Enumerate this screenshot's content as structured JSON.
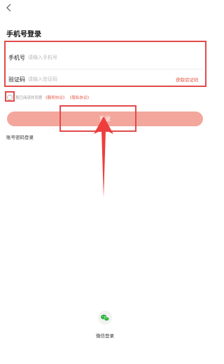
{
  "header": {
    "title": "手机号登录"
  },
  "form": {
    "phone_label": "手机号",
    "phone_placeholder": "请输入手机号",
    "code_label": "验证码",
    "code_placeholder": "请输入验证码",
    "get_code_label": "获取验证码"
  },
  "agreement": {
    "prefix": "我已阅读并同意",
    "service_link": "《服务协议》",
    "privacy_link": "《隐私协议》"
  },
  "actions": {
    "login_label": "登录",
    "password_login_label": "账号密码登录"
  },
  "third_party": {
    "wechat_label": "微信登录"
  },
  "colors": {
    "accent": "#e0533f",
    "login_button": "#f3a79c",
    "annotation": "#e24a4a",
    "wechat": "#29b33b"
  },
  "icons": {
    "back": "chevron-left-icon",
    "wechat": "wechat-icon",
    "annotation_arrow": "up-arrow-icon"
  }
}
